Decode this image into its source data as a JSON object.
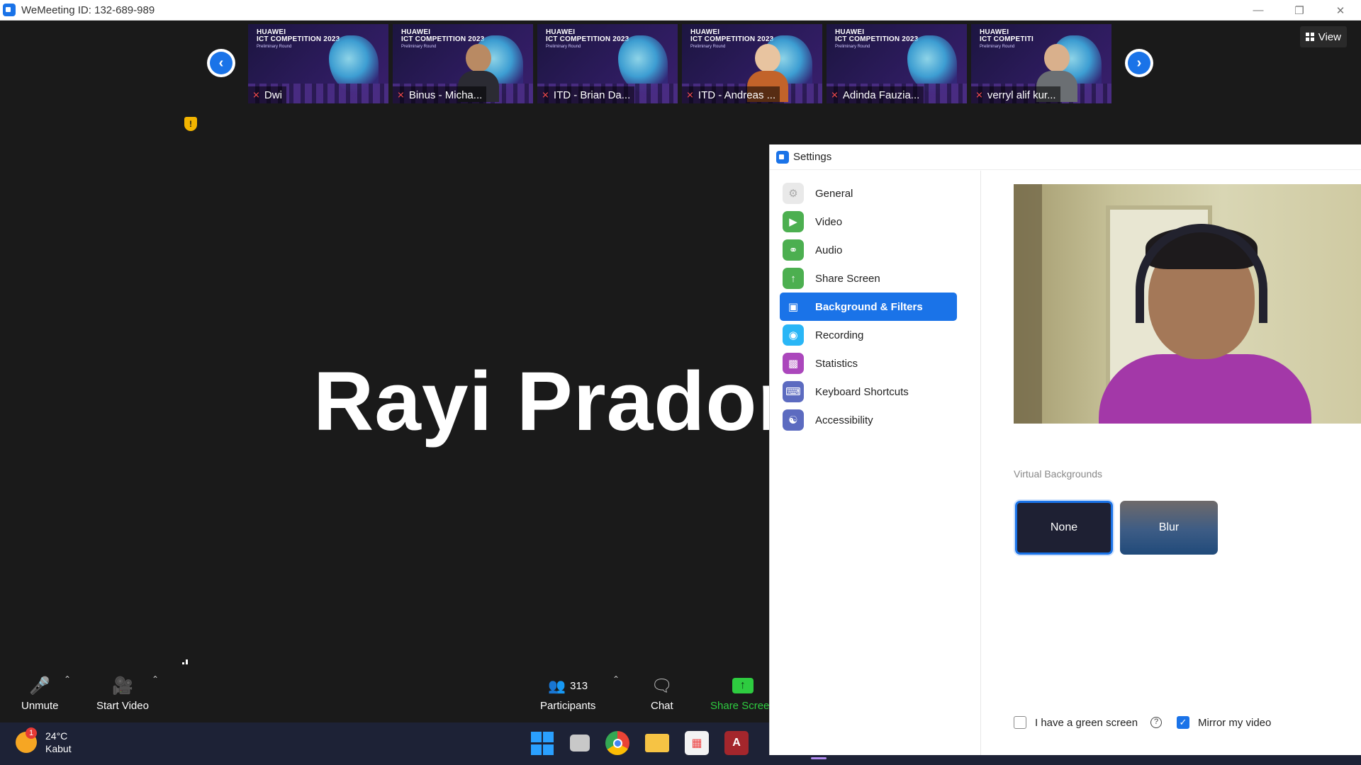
{
  "window": {
    "title": "WeMeeting ID: 132-689-989",
    "controls": [
      "minimize-icon",
      "restore-icon",
      "close-icon"
    ]
  },
  "meeting": {
    "view_label": "View",
    "speaker_name": "Rayi  Pradon",
    "thumbnails": [
      {
        "name": "Dwi",
        "brand": "HUAWEI\nICT COMPETITION 2023",
        "sub": "Preliminary Round",
        "has_video": false
      },
      {
        "name": "Binus - Micha...",
        "brand": "HUAWEI\nICT COMPETITION 2023",
        "sub": "Preliminary Round",
        "has_video": true
      },
      {
        "name": "ITD - Brian Da...",
        "brand": "HUAWEI\nICT COMPETITION 2023",
        "sub": "Preliminary Round",
        "has_video": false
      },
      {
        "name": "ITD - Andreas ...",
        "brand": "HUAWEI\nICT COMPETITION 2023",
        "sub": "Preliminary Round",
        "has_video": true
      },
      {
        "name": "Adinda Fauzia...",
        "brand": "HUAWEI\nICT COMPETITION 2023",
        "sub": "Preliminary Round",
        "has_video": false
      },
      {
        "name": "verryl alif kur...",
        "brand": "HUAWEI\nICT COMPETITI",
        "sub": "Preliminary Round",
        "has_video": true
      }
    ]
  },
  "toolbar": {
    "unmute": "Unmute",
    "start_video": "Start Video",
    "participants": "Participants",
    "participants_count": "313",
    "chat": "Chat",
    "share_screen": "Share Screen"
  },
  "taskbar": {
    "weather_temp": "24°C",
    "weather_desc": "Kabut",
    "weather_badge": "1",
    "apps": [
      "windows-start-icon",
      "task-view-icon",
      "chrome-icon",
      "file-explorer-icon",
      "store-icon",
      "access-icon"
    ]
  },
  "settings": {
    "title": "Settings",
    "nav": [
      {
        "label": "General",
        "icon": "gear-icon",
        "color": "#e9e9e9"
      },
      {
        "label": "Video",
        "icon": "video-camera-icon",
        "color": "#4caf50"
      },
      {
        "label": "Audio",
        "icon": "headphones-icon",
        "color": "#4caf50"
      },
      {
        "label": "Share Screen",
        "icon": "share-screen-icon",
        "color": "#4caf50"
      },
      {
        "label": "Background & Filters",
        "icon": "background-icon",
        "color": "#1a73e8",
        "active": true
      },
      {
        "label": "Recording",
        "icon": "record-icon",
        "color": "#29b6f6"
      },
      {
        "label": "Statistics",
        "icon": "statistics-icon",
        "color": "#ab47bc"
      },
      {
        "label": "Keyboard Shortcuts",
        "icon": "keyboard-icon",
        "color": "#5c6bc0"
      },
      {
        "label": "Accessibility",
        "icon": "accessibility-icon",
        "color": "#5c6bc0"
      }
    ],
    "virtual_backgrounds_label": "Virtual Backgrounds",
    "vb_none": "None",
    "vb_blur": "Blur",
    "green_screen_label": "I have a green screen",
    "green_screen_checked": false,
    "mirror_label": "Mirror my video",
    "mirror_checked": true
  },
  "colors": {
    "accent": "#1a73e8",
    "share_green": "#2ecc40",
    "mic_off_red": "#ff4d4d"
  }
}
